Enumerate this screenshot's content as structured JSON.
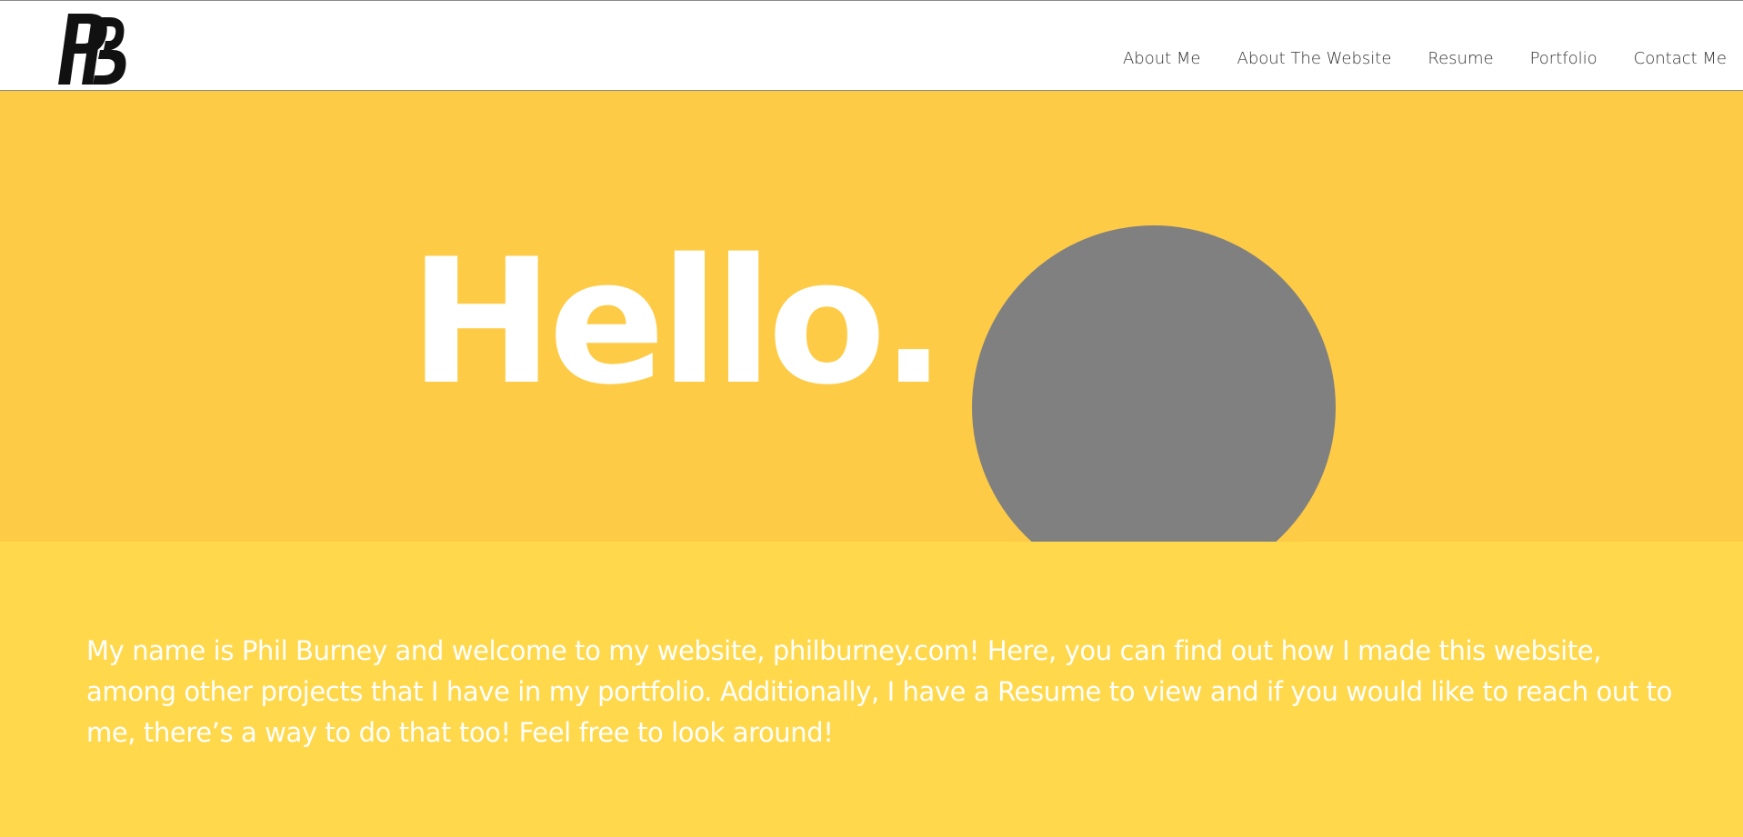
{
  "header": {
    "logo_text": "PB",
    "nav": [
      {
        "label": "About Me"
      },
      {
        "label": "About The Website"
      },
      {
        "label": "Resume"
      },
      {
        "label": "Portfolio"
      },
      {
        "label": "Contact Me"
      }
    ]
  },
  "hero": {
    "title": "Hello.",
    "background": "#fdcb45",
    "avatar_color": "#808080"
  },
  "intro": {
    "text": "My name is Phil Burney and welcome to my website, philburney.com! Here, you can find out how I made this website, among other projects that I have in my portfolio. Additionally, I have a Resume to view and if you would like to reach out to me, there’s a way to do that too! Feel free to look around!",
    "background": "#ffd84c"
  }
}
